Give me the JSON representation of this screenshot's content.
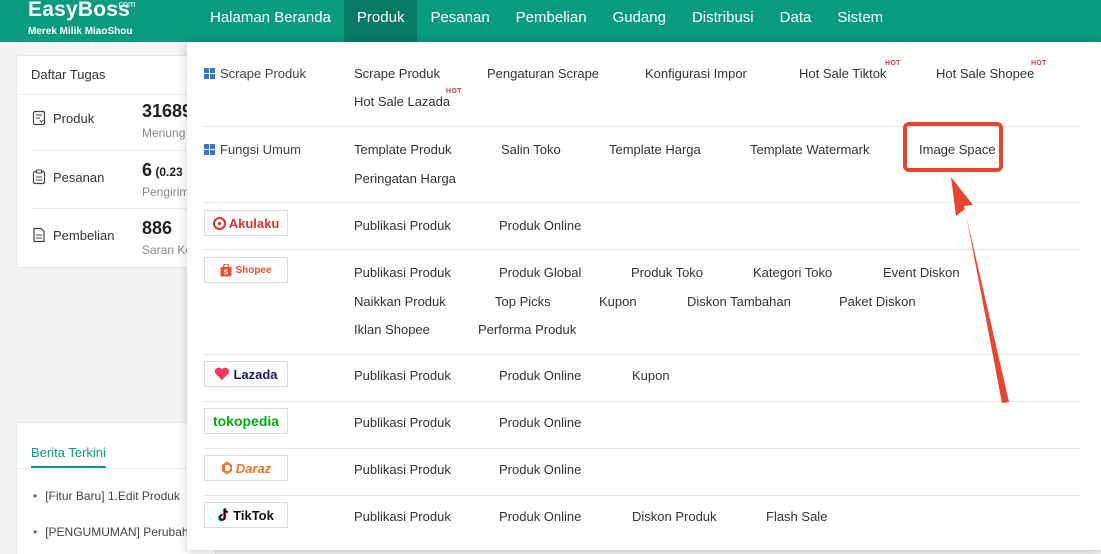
{
  "logo": {
    "main": "EasyBoss",
    "com": ".com",
    "sub": "Merek Milik MiaoShou"
  },
  "nav": [
    "Halaman Beranda",
    "Produk",
    "Pesanan",
    "Pembelian",
    "Gudang",
    "Distribusi",
    "Data",
    "Sistem"
  ],
  "tasks": {
    "title": "Daftar Tugas",
    "rows": [
      {
        "label": "Produk",
        "number": "31689",
        "extra": "",
        "sub": "Menung"
      },
      {
        "label": "Pesanan",
        "number": "6",
        "extra": " (0.23",
        "sub": "Pengirim"
      },
      {
        "label": "Pembelian",
        "number": "886",
        "extra": "",
        "sub": "Saran Ke"
      }
    ]
  },
  "news": {
    "title": "Berita Terkini",
    "items": [
      "[Fitur Baru] 1.Edit Produk",
      "[PENGUMUMAN] Perubah"
    ]
  },
  "dropdown": {
    "scrape": {
      "title": "Scrape Produk",
      "items": [
        "Scrape Produk",
        "Pengaturan Scrape",
        "Konfigurasi Impor",
        "Hot Sale Tiktok",
        "Hot Sale Shopee",
        "Hot Sale Lazada"
      ]
    },
    "umum": {
      "title": "Fungsi Umum",
      "items": [
        "Template Produk",
        "Salin Toko",
        "Template Harga",
        "Template Watermark",
        "Image Space",
        "Peringatan Harga"
      ]
    },
    "hot_badge": "HOT",
    "akulaku": {
      "brand": "Akulaku",
      "items": [
        "Publikasi Produk",
        "Produk Online"
      ]
    },
    "shopee": {
      "brand": "Shopee",
      "items": [
        "Publikasi Produk",
        "Produk Global",
        "Produk Toko",
        "Kategori Toko",
        "Event Diskon",
        "Naikkan Produk",
        "Top Picks",
        "Kupon",
        "Diskon Tambahan",
        "Paket Diskon",
        "Iklan Shopee",
        "Performa Produk"
      ]
    },
    "lazada": {
      "brand": "Lazada",
      "items": [
        "Publikasi Produk",
        "Produk Online",
        "Kupon"
      ]
    },
    "tokopedia": {
      "brand": "tokopedia",
      "items": [
        "Publikasi Produk",
        "Produk Online"
      ]
    },
    "daraz": {
      "brand": "Daraz",
      "items": [
        "Publikasi Produk",
        "Produk Online"
      ]
    },
    "tiktok": {
      "brand": "TikTok",
      "items": [
        "Publikasi Produk",
        "Produk Online",
        "Diskon Produk",
        "Flash Sale"
      ]
    }
  },
  "colors": {
    "brand_green": "#0a9a7d",
    "highlight_red": "#e8452f",
    "hot_red": "#e53935"
  }
}
